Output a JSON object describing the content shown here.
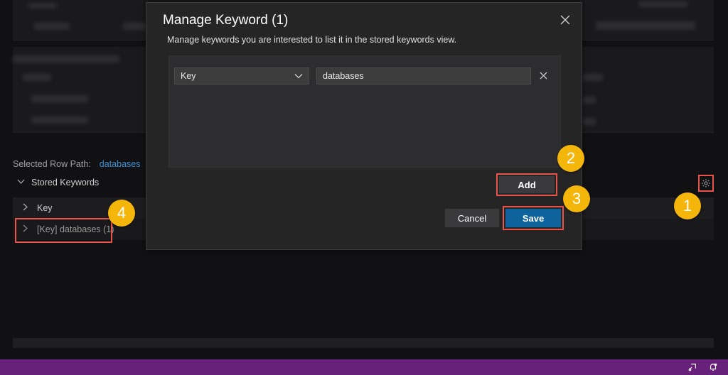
{
  "background": {
    "selected_row_path_label": "Selected Row Path:",
    "selected_row_path_value": "databases",
    "stored_keywords_header": "Stored Keywords",
    "tree_items": [
      {
        "label": "Key"
      },
      {
        "label": "[Key] databases (1)"
      }
    ]
  },
  "dialog": {
    "title": "Manage Keyword (1)",
    "description": "Manage keywords you are interested to list it in the stored keywords view.",
    "keyword_row": {
      "type_selected": "Key",
      "value": "databases"
    },
    "add_label": "Add",
    "cancel_label": "Cancel",
    "save_label": "Save"
  },
  "markers": [
    "1",
    "2",
    "3",
    "4"
  ],
  "colors": {
    "highlight": "#e8534a",
    "marker": "#f5b60c",
    "primary_button": "#0e639c",
    "status_bar": "#68217a"
  },
  "icons": {
    "settings": "gear-icon",
    "close": "close-icon",
    "remove": "remove-keyword-icon",
    "dropdown": "chevron-down-icon",
    "status_left": "feedback-icon",
    "status_right": "notification-bell-icon"
  }
}
